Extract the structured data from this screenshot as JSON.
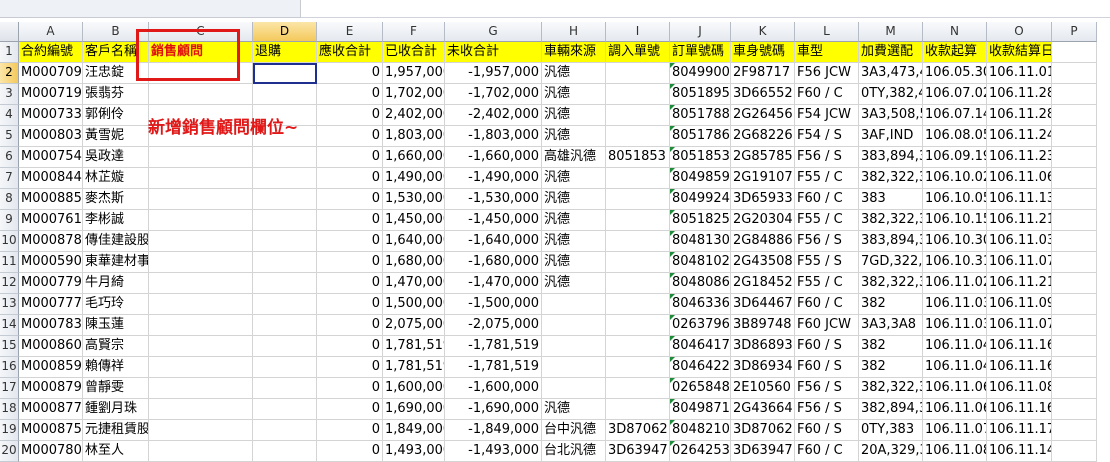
{
  "columns": [
    "A",
    "B",
    "C",
    "D",
    "E",
    "F",
    "G",
    "H",
    "I",
    "J",
    "K",
    "L",
    "M",
    "N",
    "O",
    "P"
  ],
  "header_row": [
    "合約編號",
    "客戶名稱",
    "銷售顧問",
    "退購",
    "應收合計",
    "已收合計",
    "未收合計",
    "車輛來源",
    "調入單號",
    "訂單號碼",
    "車身號碼",
    "車型",
    "加費選配",
    "收款起算",
    "收款結算日",
    ""
  ],
  "annotation": "新增銷售顧問欄位~",
  "rows": [
    {
      "num": "2",
      "cells": [
        "M000709",
        "汪忠錠",
        "",
        "",
        "0",
        "1,957,000",
        "-1,957,000",
        "汎德",
        "",
        "8049900",
        "2F98717",
        "F56 JCW",
        "3A3,473,4",
        "106.05.30",
        "106.11.01",
        ""
      ]
    },
    {
      "num": "3",
      "cells": [
        "M000719",
        "張翡芬",
        "",
        "",
        "0",
        "1,702,000",
        "-1,702,000",
        "汎德",
        "",
        "8051895",
        "3D66552",
        "F60 / C",
        "0TY,382,4",
        "106.07.02",
        "106.11.28",
        ""
      ]
    },
    {
      "num": "4",
      "cells": [
        "M000733",
        "郭俐伶",
        "",
        "",
        "0",
        "2,402,000",
        "-2,402,000",
        "汎德",
        "",
        "8051788",
        "2G26456",
        "F54 JCW",
        "3A3,508,5",
        "106.07.14",
        "106.11.28",
        ""
      ]
    },
    {
      "num": "5",
      "cells": [
        "M000803",
        "黃雪妮",
        "",
        "",
        "0",
        "1,803,000",
        "-1,803,000",
        "汎德",
        "",
        "8051786",
        "2G68226",
        "F54 / S",
        "3AF,IND",
        "106.08.05",
        "106.11.24",
        ""
      ]
    },
    {
      "num": "6",
      "cells": [
        "M000754",
        "吳政達",
        "",
        "",
        "0",
        "1,660,000",
        "-1,660,000",
        "高雄汎德",
        "8051853",
        "8051853",
        "2G85785",
        "F56 / S",
        "383,894,3",
        "106.09.19",
        "106.11.23",
        ""
      ]
    },
    {
      "num": "7",
      "cells": [
        "M000844",
        "林芷嫙",
        "",
        "",
        "0",
        "1,490,000",
        "-1,490,000",
        "汎德",
        "",
        "8049859",
        "2G19107",
        "F55 / C",
        "382,322,3",
        "106.10.02",
        "106.11.06",
        ""
      ]
    },
    {
      "num": "8",
      "cells": [
        "M000885",
        "麥杰斯",
        "",
        "",
        "0",
        "1,530,000",
        "-1,530,000",
        "汎德",
        "",
        "8049924",
        "3D65933",
        "F60 / C",
        "383",
        "106.10.05",
        "106.11.13",
        ""
      ]
    },
    {
      "num": "9",
      "cells": [
        "M000761",
        "李彬誠",
        "",
        "",
        "0",
        "1,450,000",
        "-1,450,000",
        "汎德",
        "",
        "8051825",
        "2G20304",
        "F55 / C",
        "382,322,3",
        "106.10.15",
        "106.11.21",
        ""
      ]
    },
    {
      "num": "10",
      "cells": [
        "M000878",
        "傳佳建設股份有限公司",
        "",
        "",
        "0",
        "1,640,000",
        "-1,640,000",
        "汎德",
        "",
        "8048130",
        "2G84886",
        "F56 / S",
        "383,894,3",
        "106.10.30",
        "106.11.03",
        ""
      ]
    },
    {
      "num": "11",
      "cells": [
        "M000590",
        "東華建材事業有限公司",
        "",
        "",
        "0",
        "1,680,000",
        "-1,680,000",
        "汎德",
        "",
        "8048102",
        "2G43508",
        "F55 / S",
        "7GD,322,3",
        "106.10.31",
        "106.11.07",
        ""
      ]
    },
    {
      "num": "12",
      "cells": [
        "M000779",
        "牛月綺",
        "",
        "",
        "0",
        "1,470,000",
        "-1,470,000",
        "汎德",
        "",
        "8048086",
        "2G18452",
        "F55 / C",
        "382,322,3",
        "106.11.02",
        "106.11.21",
        ""
      ]
    },
    {
      "num": "13",
      "cells": [
        "M000777",
        "毛巧玲",
        "",
        "",
        "0",
        "1,500,000",
        "-1,500,000",
        "",
        "",
        "8046336",
        "3D64467",
        "F60 / C",
        "382",
        "106.11.03",
        "106.11.09",
        ""
      ]
    },
    {
      "num": "14",
      "cells": [
        "M000783",
        "陳玉蓮",
        "",
        "",
        "0",
        "2,075,000",
        "-2,075,000",
        "",
        "",
        "0263796",
        "3B89748",
        "F60 JCW",
        "3A3,3A8",
        "106.11.03",
        "106.11.07",
        ""
      ]
    },
    {
      "num": "15",
      "cells": [
        "M000860",
        "高賢宗",
        "",
        "",
        "0",
        "1,781,519",
        "-1,781,519",
        "",
        "",
        "8046417",
        "3D86893",
        "F60 / S",
        "382",
        "106.11.04",
        "106.11.16",
        ""
      ]
    },
    {
      "num": "16",
      "cells": [
        "M000859",
        "賴傳祥",
        "",
        "",
        "0",
        "1,781,519",
        "-1,781,519",
        "",
        "",
        "8046422",
        "3D86934",
        "F60 / S",
        "382",
        "106.11.04",
        "106.11.16",
        ""
      ]
    },
    {
      "num": "17",
      "cells": [
        "M000879",
        "曾靜雯",
        "",
        "",
        "0",
        "1,600,000",
        "-1,600,000",
        "",
        "",
        "0265848",
        "2E10560",
        "F56 / S",
        "382,322,3",
        "106.11.06",
        "106.11.08",
        ""
      ]
    },
    {
      "num": "18",
      "cells": [
        "M000877",
        "鍾劉月珠",
        "",
        "",
        "0",
        "1,690,000",
        "-1,690,000",
        "汎德",
        "",
        "8049871",
        "2G43664",
        "F56 / S",
        "382,894,3",
        "106.11.06",
        "106.11.16",
        ""
      ]
    },
    {
      "num": "19",
      "cells": [
        "M000875",
        "元捷租賃股份有限公司",
        "",
        "",
        "0",
        "1,849,000",
        "-1,849,000",
        "台中汎德",
        "3D87062",
        "8048210",
        "3D87062",
        "F60 / S",
        "0TY,383",
        "106.11.07",
        "106.11.17",
        ""
      ]
    },
    {
      "num": "20",
      "cells": [
        "M000780",
        "林至人",
        "",
        "",
        "0",
        "1,493,000",
        "-1,493,000",
        "台北汎德",
        "3D63947",
        "0264253",
        "3D63947",
        "F60 / C",
        "20A,329,3",
        "106.11.08",
        "106.11.14",
        ""
      ]
    }
  ]
}
